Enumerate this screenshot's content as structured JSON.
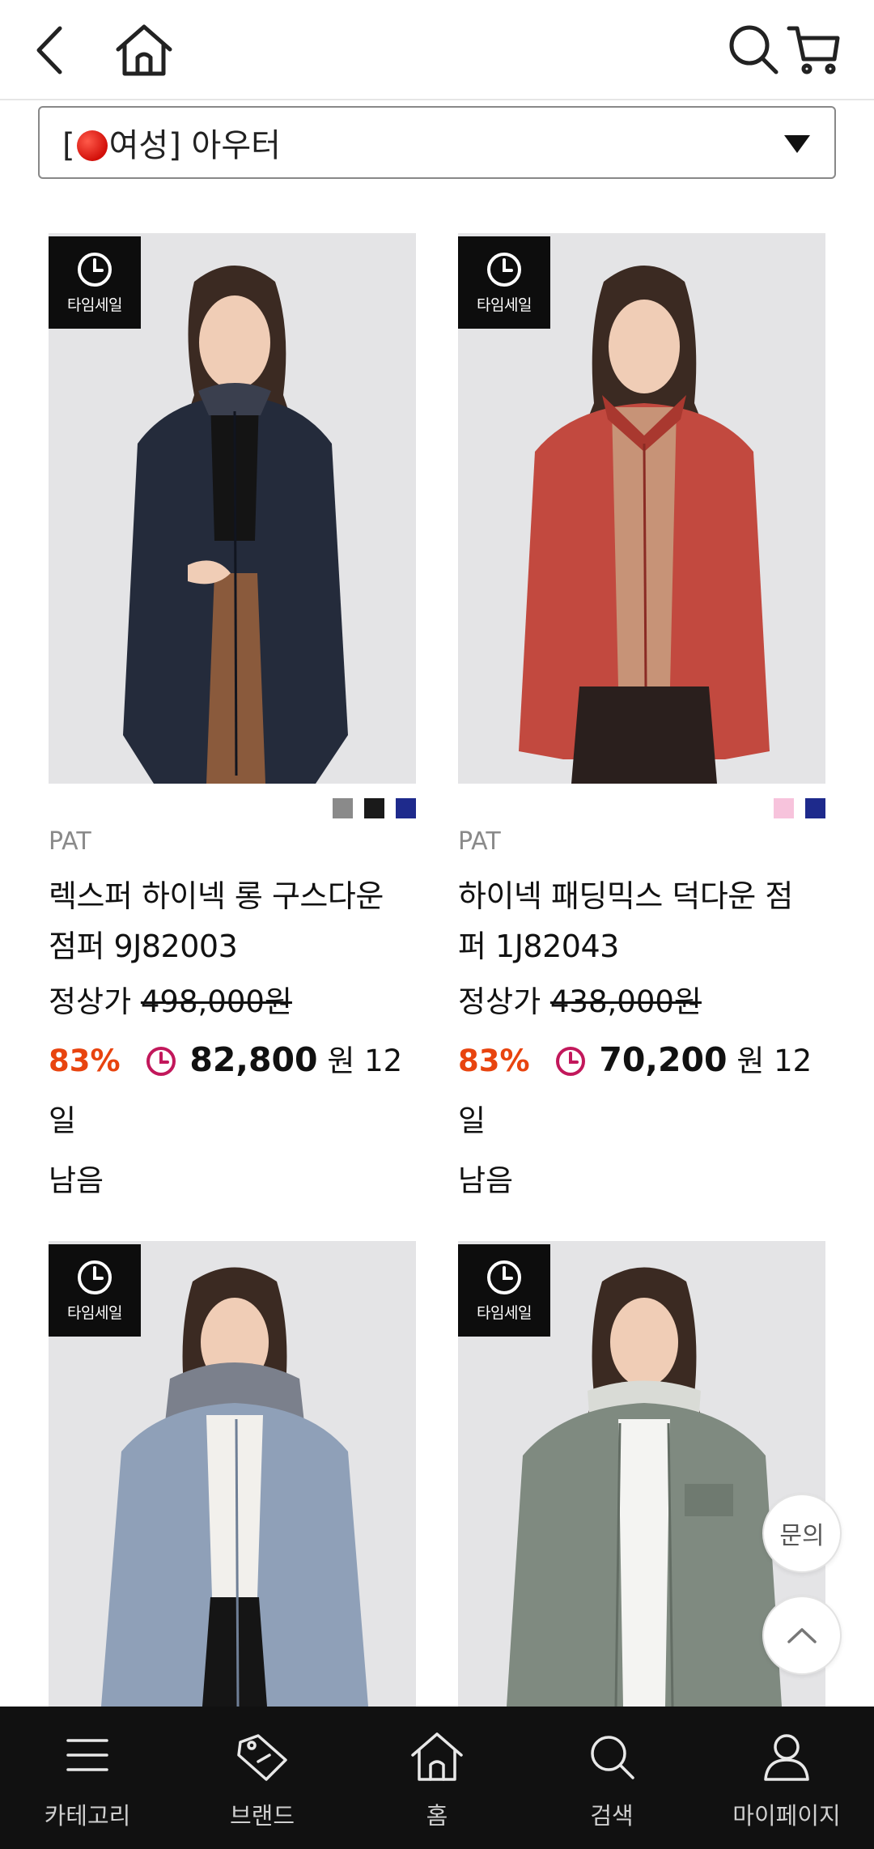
{
  "category": {
    "prefix": "[",
    "label": "여성] 아우터"
  },
  "time_sale_label": "타임세일",
  "products": [
    {
      "brand": "PAT",
      "name_line1": "렉스퍼 하이넥 롱 구스다운",
      "name_line2": "점퍼 9J82003",
      "regular_label": "정상가",
      "regular_price": "498,000원",
      "discount": "83%",
      "sale_price": "82,800",
      "sale_unit": "원 12일",
      "remain": "남음",
      "swatches": [
        "#8a8a8a",
        "#1a1a1a",
        "#1e2a8c"
      ]
    },
    {
      "brand": "PAT",
      "name_line1": "하이넥 패딩믹스 덕다운 점",
      "name_line2": "퍼 1J82043",
      "regular_label": "정상가",
      "regular_price": "438,000원",
      "discount": "83%",
      "sale_price": "70,200",
      "sale_unit": "원 12일",
      "remain": "남음",
      "swatches": [
        "#f7c3dc",
        "#1e2a8c"
      ]
    },
    {
      "time_sale": true
    },
    {
      "time_sale": true
    }
  ],
  "floating": {
    "inquiry": "문의"
  },
  "bottom_nav": [
    {
      "label": "카테고리",
      "icon": "menu-icon"
    },
    {
      "label": "브랜드",
      "icon": "tag-icon"
    },
    {
      "label": "홈",
      "icon": "home-icon"
    },
    {
      "label": "검색",
      "icon": "search-icon"
    },
    {
      "label": "마이페이지",
      "icon": "user-icon"
    }
  ]
}
